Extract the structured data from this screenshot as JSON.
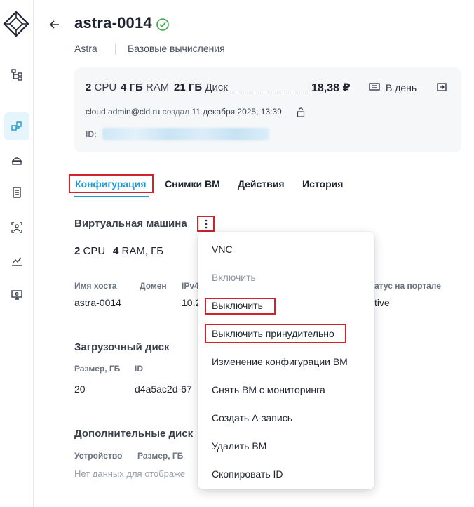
{
  "header": {
    "title": "astra-0014",
    "breadcrumb": [
      "Astra",
      "Базовые вычисления"
    ]
  },
  "summary": {
    "cpu_value": "2",
    "cpu_unit": "CPU",
    "ram_value": "4 ГБ",
    "ram_unit": "RAM",
    "disk_value": "21 ГБ",
    "disk_unit": "Диск",
    "price": "18,38 ₽",
    "period": "В день",
    "owner": "cloud.admin@cld.ru",
    "created_label": "создал",
    "created_at": "11 декабря 2025, 13:39",
    "id_label": "ID:"
  },
  "tabs": [
    "Конфигурация",
    "Снимки ВМ",
    "Действия",
    "История"
  ],
  "vm_section": {
    "title": "Виртуальная машина",
    "cpu_value": "2",
    "cpu_unit": "CPU",
    "ram_value": "4",
    "ram_unit": "RAM, ГБ",
    "columns": [
      "Имя хоста",
      "Домен",
      "IPv4",
      "атус на портале"
    ],
    "row": [
      "astra-0014",
      "",
      "10.2",
      "tive"
    ]
  },
  "boot_disk": {
    "title": "Загрузочный диск",
    "columns": [
      "Размер, ГБ",
      "ID"
    ],
    "row": [
      "20",
      "d4a5ac2d-67"
    ]
  },
  "extra_disks": {
    "title": "Дополнительные диск",
    "columns": [
      "Устройство",
      "Размер, ГБ"
    ],
    "empty_text": "Нет данных для отображе"
  },
  "menu": {
    "items": [
      {
        "label": "VNC"
      },
      {
        "label": "Включить",
        "disabled": true
      },
      {
        "label": "Выключить"
      },
      {
        "label": "Выключить принудительно"
      },
      {
        "label": "Изменение конфигурации ВМ"
      },
      {
        "label": "Снять ВМ с мониторинга"
      },
      {
        "label": "Создать А-запись"
      },
      {
        "label": "Удалить ВМ"
      },
      {
        "label": "Скопировать ID"
      }
    ]
  },
  "colors": {
    "accent": "#1e9bd0",
    "success": "#3aa64a",
    "highlight_box": "#d0232b"
  }
}
